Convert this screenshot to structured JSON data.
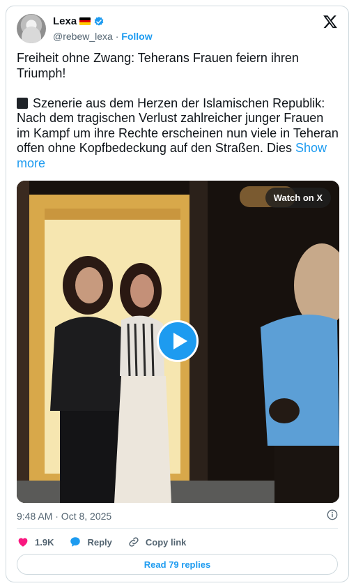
{
  "author": {
    "name": "Lexa",
    "handle": "@rebew_lexa",
    "separator": "·",
    "follow_label": "Follow",
    "flag": "german-flag",
    "verified_color": "#1d9bf0"
  },
  "tweet": {
    "text": "Freiheit ohne Zwang: Teherans Frauen feiern ihren Triumph!\n\n",
    "text_body": "Szenerie aus dem Herzen der Islamischen Republik: Nach dem tragischen Verlust zahlreicher junger Frauen im Kampf um ihre Rechte erscheinen nun viele in Teheran offen ohne Kopfbedeckung auf den Straßen. Dies ",
    "show_more_label": "Show more"
  },
  "media": {
    "watch_label": "Watch on X",
    "play_icon": "play-icon"
  },
  "timestamp": "9:48 AM · Oct 8, 2025",
  "actions": {
    "likes": "1.9K",
    "reply_label": "Reply",
    "copy_link_label": "Copy link"
  },
  "read_replies_label": "Read 79 replies",
  "colors": {
    "accent": "#1d9bf0",
    "like": "#f91880",
    "muted": "#536471"
  }
}
